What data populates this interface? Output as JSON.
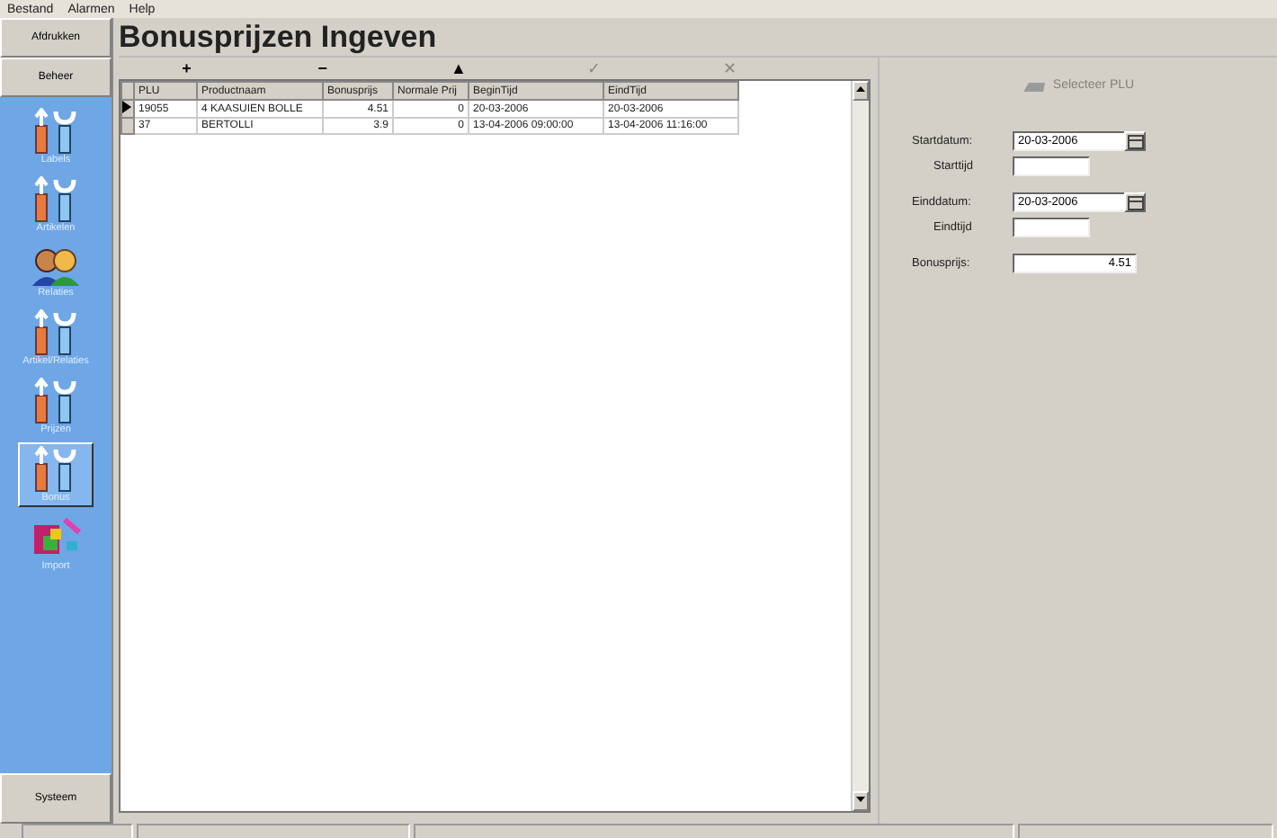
{
  "menu": [
    "Bestand",
    "Alarmen",
    "Help"
  ],
  "sidebar": {
    "top_buttons": [
      "Afdrukken",
      "Beheer"
    ],
    "items": [
      {
        "label": "Labels",
        "kind": "tools",
        "selected": false
      },
      {
        "label": "Artikelen",
        "kind": "tools",
        "selected": false
      },
      {
        "label": "Relaties",
        "kind": "people",
        "selected": false
      },
      {
        "label": "Artikel/Relaties",
        "kind": "tools",
        "selected": false
      },
      {
        "label": "Prijzen",
        "kind": "tools",
        "selected": false
      },
      {
        "label": "Bonus",
        "kind": "tools",
        "selected": true
      },
      {
        "label": "Import",
        "kind": "cubes",
        "selected": false
      }
    ],
    "bottom_button": "Systeem"
  },
  "title": "Bonusprijzen Ingeven",
  "navigator": [
    {
      "symbol": "+",
      "disabled": false
    },
    {
      "symbol": "−",
      "disabled": false
    },
    {
      "symbol": "▲",
      "disabled": false
    },
    {
      "symbol": "✓",
      "disabled": true
    },
    {
      "symbol": "✕",
      "disabled": true
    }
  ],
  "table": {
    "columns": [
      "PLU",
      "Productnaam",
      "Bonusprijs",
      "Normale Prij",
      "BeginTijd",
      "EindTijd"
    ],
    "rows": [
      {
        "cells": [
          "19055",
          "4 KAASUIEN BOLLE",
          "4.51",
          "0",
          "20-03-2006",
          "20-03-2006"
        ],
        "selected": true
      },
      {
        "cells": [
          "37",
          "BERTOLLI",
          "3.9",
          "0",
          "13-04-2006 09:00:00",
          "13-04-2006 11:16:00"
        ],
        "selected": false
      }
    ]
  },
  "form": {
    "select_button": {
      "label": "Selecteer PLU",
      "disabled": true
    },
    "fields": [
      {
        "label": "Startdatum:",
        "value": "20-03-2006",
        "kind": "date"
      },
      {
        "label": "Starttijd",
        "kind": "text"
      },
      {
        "label": "Einddatum:",
        "value": "20-03-2006",
        "kind": "date"
      },
      {
        "label": "Eindtijd",
        "kind": "text"
      },
      {
        "label": "Bonusprijs:",
        "value": "4.51",
        "kind": "number"
      }
    ]
  }
}
